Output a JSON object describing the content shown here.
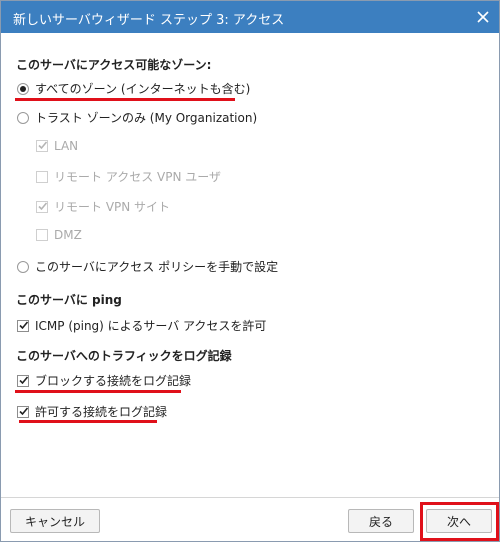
{
  "window": {
    "title": "新しいサーバウィザード ステップ 3: アクセス"
  },
  "zones": {
    "heading": "このサーバにアクセス可能なゾーン:",
    "options": [
      {
        "label": "すべてのゾーン (インターネットも含む)",
        "selected": true
      },
      {
        "label": "トラスト ゾーンのみ (My Organization)",
        "selected": false
      }
    ],
    "trust_zones": [
      {
        "label": "LAN",
        "checked": true
      },
      {
        "label": "リモート アクセス VPN ユーザ",
        "checked": false
      },
      {
        "label": "リモート VPN サイト",
        "checked": true
      },
      {
        "label": "DMZ",
        "checked": false
      }
    ],
    "manual_option": {
      "label": "このサーバにアクセス ポリシーを手動で設定",
      "selected": false
    }
  },
  "ping": {
    "heading": "このサーバに ping",
    "allow": {
      "label": "ICMP (ping) によるサーバ アクセスを許可",
      "checked": true
    }
  },
  "logging": {
    "heading": "このサーバへのトラフィックをログ記録",
    "blocked": {
      "label": "ブロックする接続をログ記録",
      "checked": true
    },
    "allowed": {
      "label": "許可する接続をログ記録",
      "checked": true
    }
  },
  "footer": {
    "cancel_label": "キャンセル",
    "back_label": "戻る",
    "next_label": "次へ"
  },
  "colors": {
    "titlebar": "#3c7fc0",
    "highlight": "#e0101a"
  }
}
